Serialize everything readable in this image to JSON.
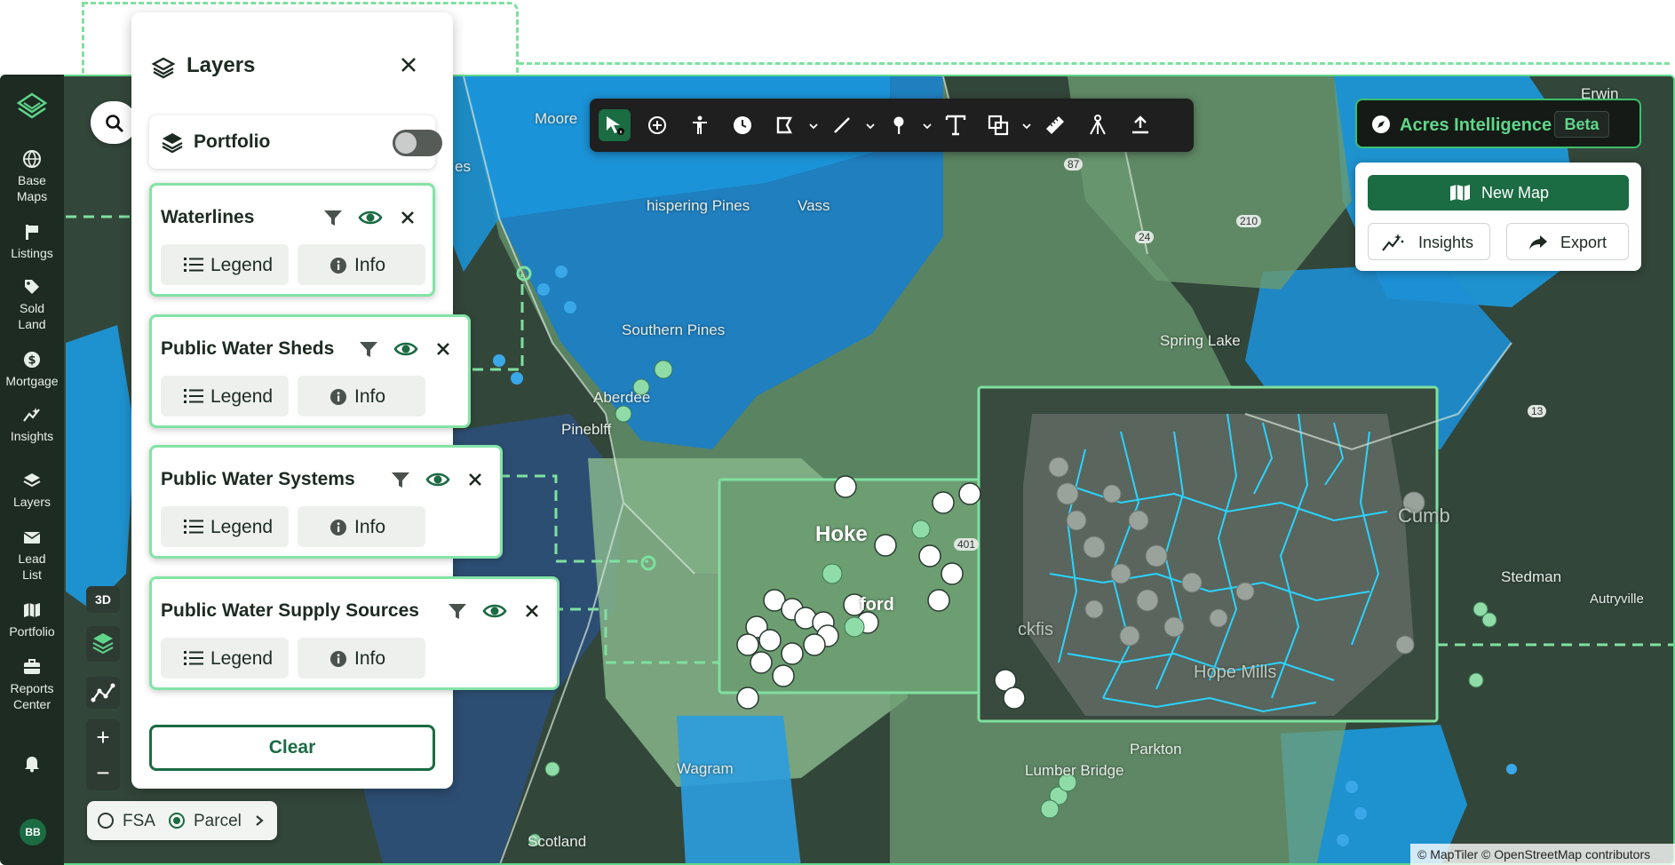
{
  "nav": {
    "items": [
      {
        "label_1": "Base",
        "label_2": "Maps",
        "icon": "globe-icon"
      },
      {
        "label_1": "Listings",
        "label_2": "",
        "icon": "flag-icon"
      },
      {
        "label_1": "Sold",
        "label_2": "Land",
        "icon": "tag-icon"
      },
      {
        "label_1": "Mortgage",
        "label_2": "",
        "icon": "dollar-icon"
      },
      {
        "label_1": "Insights",
        "label_2": "",
        "icon": "sparkle-icon"
      },
      {
        "label_1": "Layers",
        "label_2": "",
        "icon": "layers-icon"
      },
      {
        "label_1": "Lead",
        "label_2": "List",
        "icon": "mail-icon"
      },
      {
        "label_1": "Portfolio",
        "label_2": "",
        "icon": "map-icon"
      },
      {
        "label_1": "Reports",
        "label_2": "Center",
        "icon": "briefcase-icon"
      }
    ],
    "avatar": "BB"
  },
  "layers_panel": {
    "title": "Layers",
    "portfolio_label": "Portfolio",
    "portfolio_enabled": false,
    "layers": [
      {
        "name": "Waterlines",
        "legend": "Legend",
        "info": "Info"
      },
      {
        "name": "Public Water Sheds",
        "legend": "Legend",
        "info": "Info"
      },
      {
        "name": "Public Water Systems",
        "legend": "Legend",
        "info": "Info"
      },
      {
        "name": "Public Water Supply Sources",
        "legend": "Legend",
        "info": "Info"
      }
    ],
    "clear_label": "Clear"
  },
  "map_controls": {
    "three_d": "3D",
    "zoom_in": "+",
    "zoom_out": "−",
    "fsa_label": "FSA",
    "parcel_label": "Parcel",
    "selected": "Parcel"
  },
  "acres_intelligence": {
    "title": "Acres Intelligence",
    "badge": "Beta",
    "new_map": "New Map",
    "insights": "Insights",
    "export": "Export"
  },
  "map_labels": {
    "moore": "Moore",
    "whispering_pines": "hispering Pines",
    "vass": "Vass",
    "southern_pines": "Southern Pines",
    "aberdeen": "Aberdee",
    "pinebluff": "Pineblff",
    "hoke": "Hoke",
    "raeford": "ford",
    "spring_lake": "Spring Lake",
    "hope_mills": "Hope Mills",
    "fayetteville": "ckfis",
    "cumberland": "Cumb",
    "stedman": "Stedman",
    "autryville": "Autryville",
    "wagram": "Wagram",
    "laurel_bridge": "Lumber Bridge",
    "parkton": "Parkton",
    "scotland": "Scotland",
    "erwin": "Erwin",
    "dunn": "es",
    "route_401": "401",
    "route_87": "87",
    "route_24": "24",
    "route_210": "210",
    "route_13": "13"
  },
  "attribution": "© MapTiler © OpenStreetMap contributors",
  "colors": {
    "brand_green": "#1b6b43",
    "accent_green": "#5fd68a",
    "water_blue": "#1a8fd6"
  }
}
